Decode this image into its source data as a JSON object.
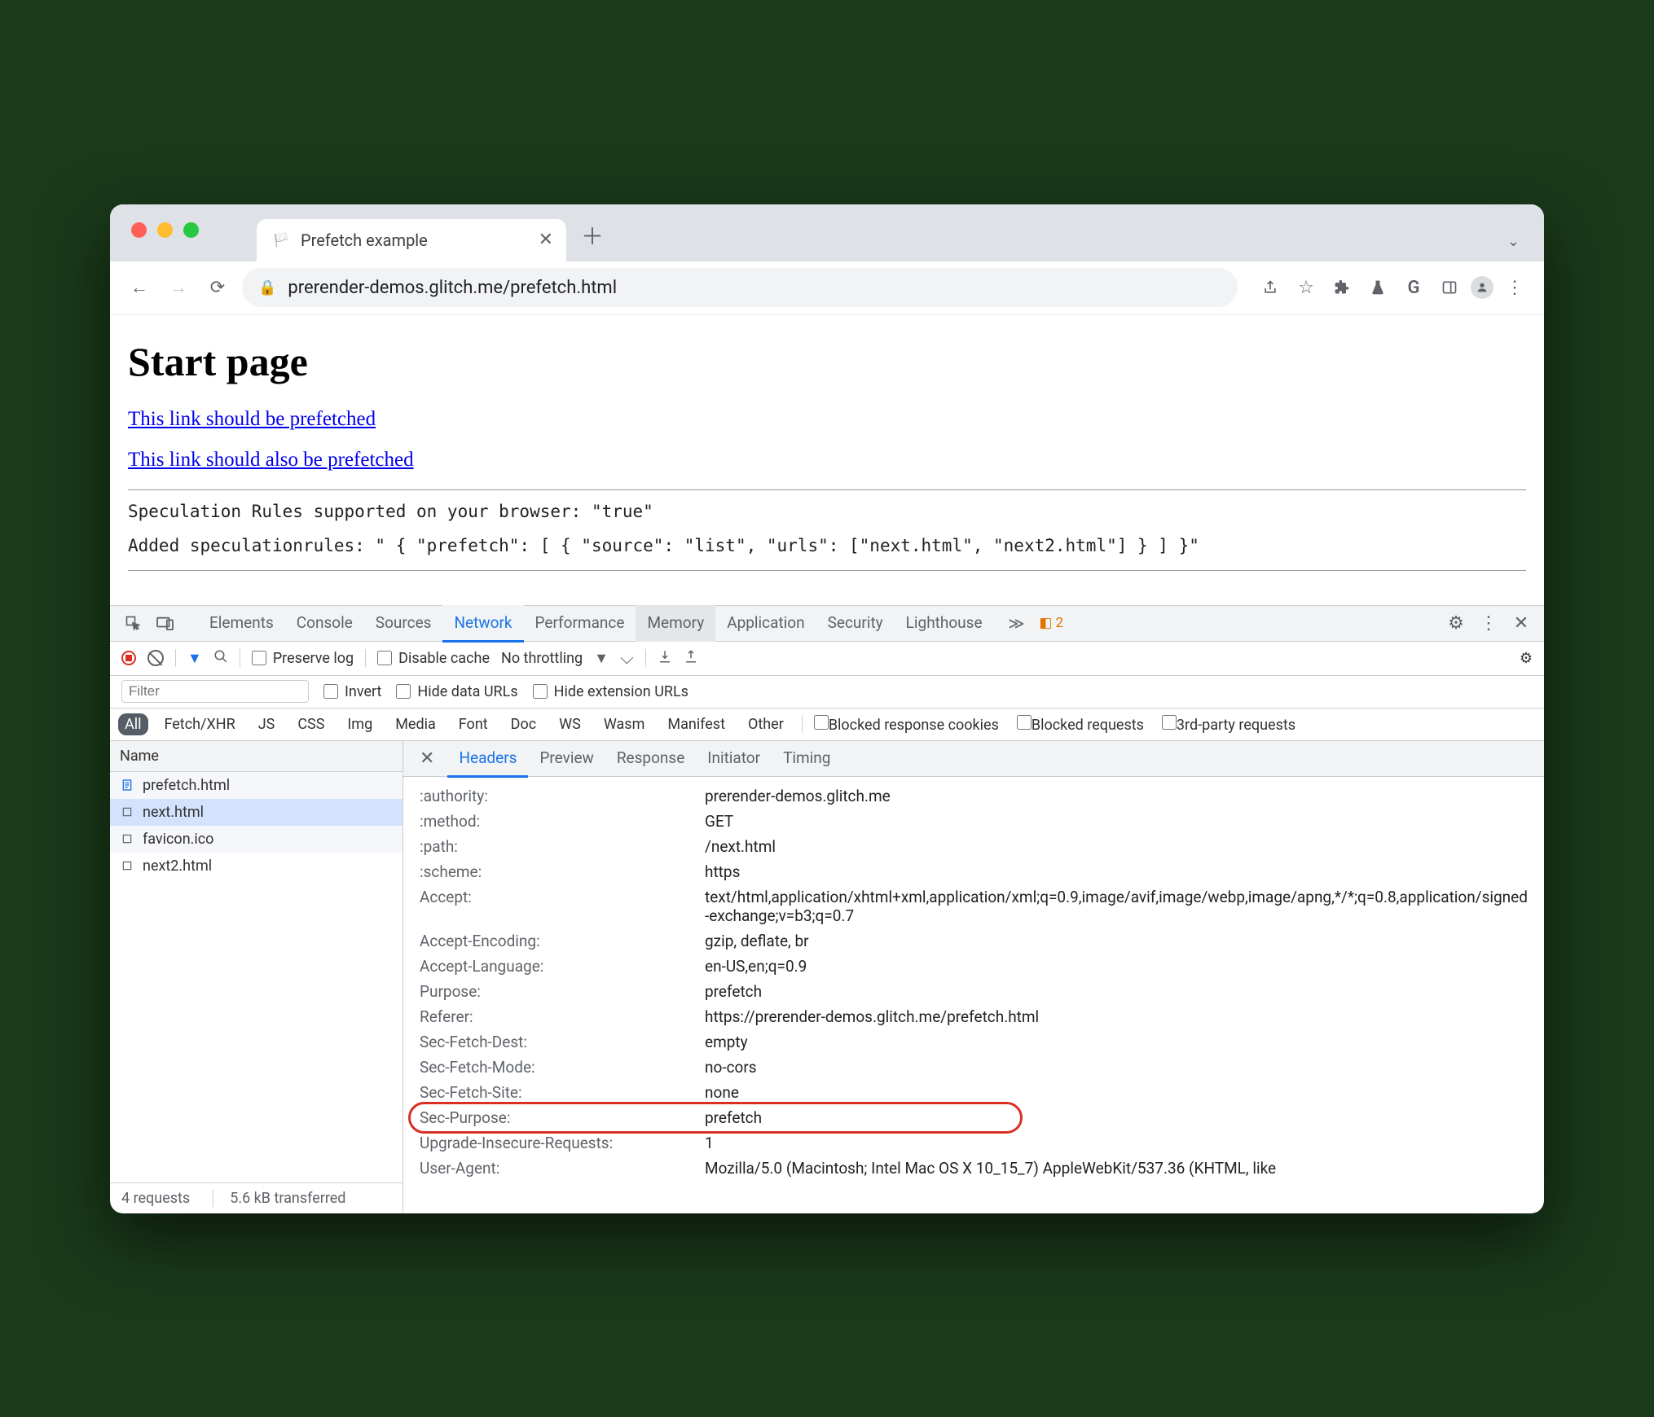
{
  "browser": {
    "tab_title": "Prefetch example",
    "url": "prerender-demos.glitch.me/prefetch.html"
  },
  "page": {
    "heading": "Start page",
    "link1": "This link should be prefetched",
    "link2": "This link should also be prefetched",
    "line1": "Speculation Rules supported on your browser: \"true\"",
    "line2": "Added speculationrules: \" { \"prefetch\": [ { \"source\": \"list\", \"urls\": [\"next.html\", \"next2.html\"] } ] }\""
  },
  "devtools": {
    "panels": [
      "Elements",
      "Console",
      "Sources",
      "Network",
      "Performance",
      "Memory",
      "Application",
      "Security",
      "Lighthouse"
    ],
    "active_panel": "Network",
    "hover_panel": "Memory",
    "more_glyph": "≫",
    "warning_count": "2",
    "controls": {
      "preserve": "Preserve log",
      "disable_cache": "Disable cache",
      "throttling": "No throttling"
    },
    "filter": {
      "placeholder": "Filter",
      "invert": "Invert",
      "hide_data": "Hide data URLs",
      "hide_ext": "Hide extension URLs"
    },
    "types": [
      "All",
      "Fetch/XHR",
      "JS",
      "CSS",
      "Img",
      "Media",
      "Font",
      "Doc",
      "WS",
      "Wasm",
      "Manifest",
      "Other"
    ],
    "type_checks": [
      "Blocked response cookies",
      "Blocked requests",
      "3rd-party requests"
    ],
    "list_header": "Name",
    "files": [
      {
        "name": "prefetch.html",
        "icon": "doc",
        "selected": false,
        "striped": true
      },
      {
        "name": "next.html",
        "icon": "box",
        "selected": true,
        "striped": false
      },
      {
        "name": "favicon.ico",
        "icon": "box",
        "selected": false,
        "striped": true
      },
      {
        "name": "next2.html",
        "icon": "box",
        "selected": false,
        "striped": false
      }
    ],
    "detail_tabs": [
      "Headers",
      "Preview",
      "Response",
      "Initiator",
      "Timing"
    ],
    "active_detail": "Headers",
    "headers": [
      {
        "k": ":authority:",
        "v": "prerender-demos.glitch.me"
      },
      {
        "k": ":method:",
        "v": "GET"
      },
      {
        "k": ":path:",
        "v": "/next.html"
      },
      {
        "k": ":scheme:",
        "v": "https"
      },
      {
        "k": "Accept:",
        "v": "text/html,application/xhtml+xml,application/xml;q=0.9,image/avif,image/webp,image/apng,*/*;q=0.8,application/signed-exchange;v=b3;q=0.7"
      },
      {
        "k": "Accept-Encoding:",
        "v": "gzip, deflate, br"
      },
      {
        "k": "Accept-Language:",
        "v": "en-US,en;q=0.9"
      },
      {
        "k": "Purpose:",
        "v": "prefetch"
      },
      {
        "k": "Referer:",
        "v": "https://prerender-demos.glitch.me/prefetch.html"
      },
      {
        "k": "Sec-Fetch-Dest:",
        "v": "empty"
      },
      {
        "k": "Sec-Fetch-Mode:",
        "v": "no-cors"
      },
      {
        "k": "Sec-Fetch-Site:",
        "v": "none"
      },
      {
        "k": "Sec-Purpose:",
        "v": "prefetch",
        "outlined": true
      },
      {
        "k": "Upgrade-Insecure-Requests:",
        "v": "1"
      },
      {
        "k": "User-Agent:",
        "v": "Mozilla/5.0 (Macintosh; Intel Mac OS X 10_15_7) AppleWebKit/537.36 (KHTML, like"
      }
    ],
    "status": {
      "requests": "4 requests",
      "transferred": "5.6 kB transferred"
    }
  }
}
